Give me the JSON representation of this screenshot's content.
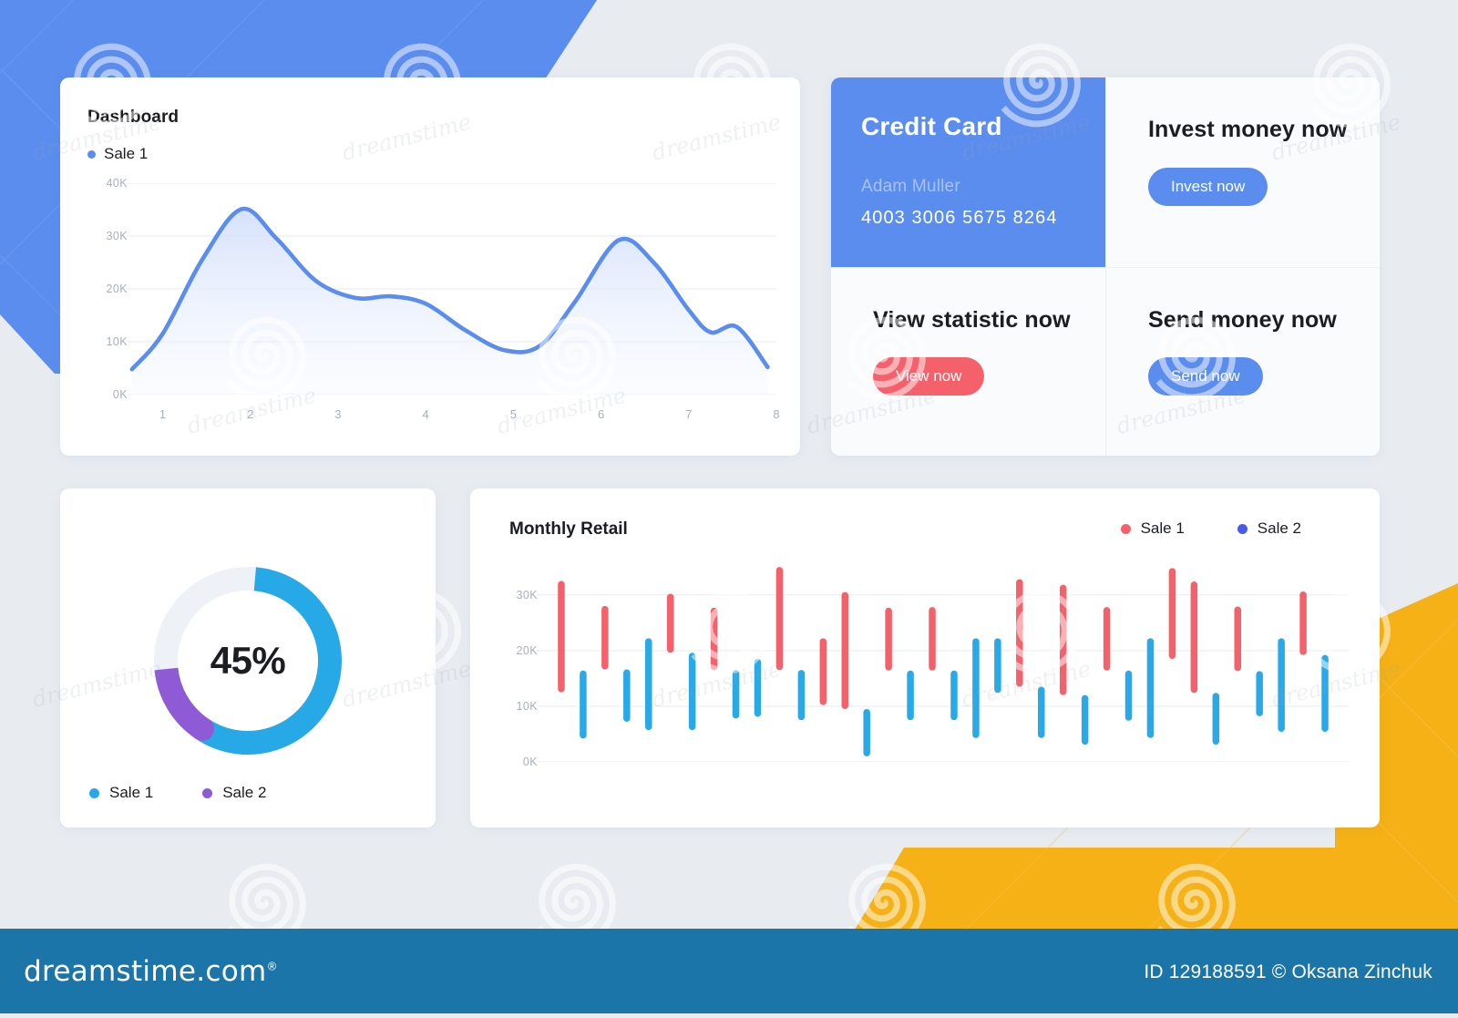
{
  "theme": {
    "blue": "#5b8def",
    "sky": "#27a9e8",
    "purple": "#8e5ad6",
    "red": "#f4616b",
    "indigo": "#4a5ae8",
    "yellow": "#f5b115",
    "page_bg": "#e8ecf1",
    "track": "#eef1f6",
    "footer_bg": "#1b75a8"
  },
  "area_card": {
    "title": "Dashboard",
    "legend": [
      {
        "label": "Sale 1",
        "color": "#5b8def"
      }
    ]
  },
  "actions_card": {
    "credit_card": {
      "title": "Credit Card",
      "holder": "Adam Muller",
      "number": "4003  3006  5675  8264"
    },
    "tiles": [
      {
        "title": "Invest money now",
        "button": "Invest now",
        "button_style": "blue"
      },
      {
        "title": "View statistic now",
        "button": "View now",
        "button_style": "red"
      },
      {
        "title": "Send money now",
        "button": "Send now",
        "button_style": "blue"
      }
    ]
  },
  "donut_card": {
    "center_value": "45%",
    "legend": [
      {
        "label": "Sale 1",
        "color": "#27a9e8"
      },
      {
        "label": "Sale 2",
        "color": "#8e5ad6"
      }
    ]
  },
  "bars_card": {
    "title": "Monthly Retail",
    "legend": [
      {
        "label": "Sale 1",
        "color": "#f4616b"
      },
      {
        "label": "Sale 2",
        "color": "#4a5ae8"
      }
    ]
  },
  "footer": {
    "logo": "dreamstime.com",
    "logo_mark": "®",
    "credit": "ID 129188591 © Oksana Zinchuk"
  },
  "chart_data": [
    {
      "id": "area-chart",
      "type": "area",
      "title": "Dashboard",
      "xlabel": "",
      "ylabel": "",
      "grid": true,
      "legend_position": "top-left",
      "x": [
        1,
        2,
        3,
        4,
        5,
        6,
        7,
        8
      ],
      "xtick_labels": [
        "1",
        "2",
        "3",
        "4",
        "5",
        "6",
        "7",
        "8"
      ],
      "ytick_labels": [
        "0K",
        "10K",
        "20K",
        "30K",
        "40K"
      ],
      "ytick_values": [
        0,
        10000,
        20000,
        30000,
        40000
      ],
      "ylim": [
        0,
        40000
      ],
      "xlim": [
        0.6,
        8.0
      ],
      "series": [
        {
          "name": "Sale 1",
          "color": "#5b8def",
          "fill": "#e8eefc",
          "x": [
            0.65,
            1.0,
            1.45,
            1.9,
            2.3,
            2.75,
            3.2,
            3.6,
            4.0,
            4.45,
            4.9,
            5.3,
            5.7,
            6.2,
            6.6,
            7.0,
            7.25,
            7.55,
            7.9
          ],
          "values": [
            4800,
            11500,
            25500,
            35100,
            29500,
            21500,
            18300,
            18600,
            17200,
            12200,
            8400,
            9200,
            17500,
            29200,
            25000,
            16000,
            11800,
            12800,
            5200
          ]
        }
      ]
    },
    {
      "id": "donut-chart",
      "type": "pie",
      "title": "",
      "center_label": "45%",
      "donut": true,
      "legend_position": "bottom-left",
      "labels": [
        "Sale 1",
        "Sale 2",
        "Remainder"
      ],
      "values": [
        58,
        14,
        28
      ],
      "colors": [
        "#27a9e8",
        "#8e5ad6",
        "#eef1f6"
      ],
      "start_angle_deg": 5
    },
    {
      "id": "monthly-retail-chart",
      "type": "bar",
      "subtype": "floating-range-bars",
      "title": "Monthly Retail",
      "xlabel": "",
      "ylabel": "",
      "grid": true,
      "legend_position": "top-right",
      "ytick_labels": [
        "0K",
        "10K",
        "20K",
        "30K"
      ],
      "ytick_values": [
        0,
        10000,
        20000,
        30000
      ],
      "ylim": [
        0,
        36000
      ],
      "series": [
        {
          "name": "Sale 1",
          "color": "#f4616b"
        },
        {
          "name": "Sale 2",
          "color": "#29a9e8"
        }
      ],
      "bars": [
        {
          "series": "Sale 1",
          "low": 12500,
          "high": 32500
        },
        {
          "series": "Sale 2",
          "low": 4200,
          "high": 16400
        },
        {
          "series": "Sale 1",
          "low": 16600,
          "high": 28000
        },
        {
          "series": "Sale 2",
          "low": 7200,
          "high": 16600
        },
        {
          "series": "Sale 2",
          "low": 5700,
          "high": 22200
        },
        {
          "series": "Sale 1",
          "low": 19600,
          "high": 30200
        },
        {
          "series": "Sale 2",
          "low": 5700,
          "high": 19600
        },
        {
          "series": "Sale 1",
          "low": 16500,
          "high": 27700
        },
        {
          "series": "Sale 2",
          "low": 7800,
          "high": 16500
        },
        {
          "series": "Sale 2",
          "low": 8100,
          "high": 18500
        },
        {
          "series": "Sale 1",
          "low": 16500,
          "high": 35000
        },
        {
          "series": "Sale 2",
          "low": 7500,
          "high": 16500
        },
        {
          "series": "Sale 1",
          "low": 10200,
          "high": 22200
        },
        {
          "series": "Sale 1",
          "low": 9500,
          "high": 30500
        },
        {
          "series": "Sale 2",
          "low": 1000,
          "high": 9500
        },
        {
          "series": "Sale 1",
          "low": 16400,
          "high": 27700
        },
        {
          "series": "Sale 2",
          "low": 7500,
          "high": 16400
        },
        {
          "series": "Sale 1",
          "low": 16400,
          "high": 27800
        },
        {
          "series": "Sale 2",
          "low": 7500,
          "high": 16400
        },
        {
          "series": "Sale 2",
          "low": 4300,
          "high": 22200
        },
        {
          "series": "Sale 2",
          "low": 12400,
          "high": 22200
        },
        {
          "series": "Sale 1",
          "low": 13500,
          "high": 32800
        },
        {
          "series": "Sale 2",
          "low": 4300,
          "high": 13500
        },
        {
          "series": "Sale 1",
          "low": 12000,
          "high": 31800
        },
        {
          "series": "Sale 2",
          "low": 3100,
          "high": 12000
        },
        {
          "series": "Sale 1",
          "low": 16400,
          "high": 27800
        },
        {
          "series": "Sale 2",
          "low": 7400,
          "high": 16400
        },
        {
          "series": "Sale 2",
          "low": 4300,
          "high": 22200
        },
        {
          "series": "Sale 1",
          "low": 18500,
          "high": 34800
        },
        {
          "series": "Sale 1",
          "low": 12400,
          "high": 32400
        },
        {
          "series": "Sale 2",
          "low": 3100,
          "high": 12400
        },
        {
          "series": "Sale 1",
          "low": 16300,
          "high": 27900
        },
        {
          "series": "Sale 2",
          "low": 8200,
          "high": 16300
        },
        {
          "series": "Sale 2",
          "low": 5400,
          "high": 22200
        },
        {
          "series": "Sale 1",
          "low": 19200,
          "high": 30600
        },
        {
          "series": "Sale 2",
          "low": 5400,
          "high": 19200
        }
      ]
    }
  ]
}
